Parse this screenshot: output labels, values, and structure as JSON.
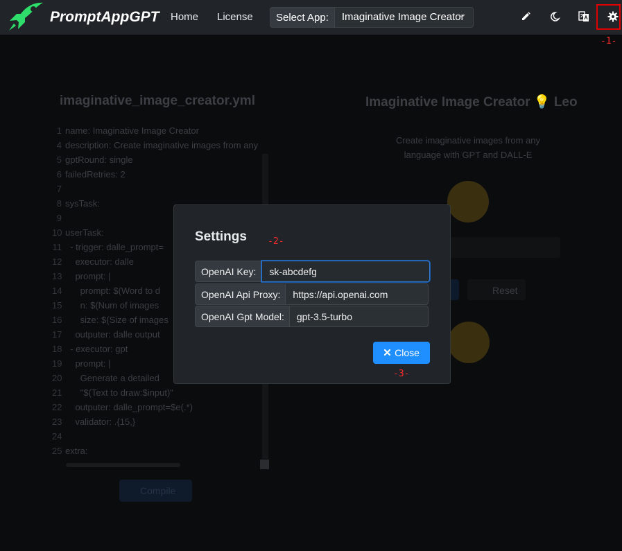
{
  "navbar": {
    "brand": "PromptAppGPT",
    "links": [
      "Home",
      "License"
    ],
    "select_label": "Select App:",
    "select_value": "Imaginative Image Creator",
    "icons": [
      "pencil-icon",
      "moon-icon",
      "translate-icon",
      "gear-icon"
    ]
  },
  "markers": {
    "m1": "-1-",
    "m2": "-2-",
    "m3": "-3-"
  },
  "background": {
    "editor_title": "imaginative_image_creator.yml",
    "code_lines": [
      {
        "n": "1",
        "t": "name: Imaginative Image Creator"
      },
      {
        "n": "4",
        "t": "description: Create imaginative images from any"
      },
      {
        "n": "5",
        "t": "gptRound: single"
      },
      {
        "n": "6",
        "t": "failedRetries: 2"
      },
      {
        "n": "7",
        "t": ""
      },
      {
        "n": "8",
        "t": "sysTask:"
      },
      {
        "n": "9",
        "t": ""
      },
      {
        "n": "10",
        "t": "userTask:"
      },
      {
        "n": "11",
        "t": "  - trigger: dalle_prompt="
      },
      {
        "n": "12",
        "t": "    executor: dalle"
      },
      {
        "n": "13",
        "t": "    prompt: |"
      },
      {
        "n": "14",
        "t": "      prompt: $(Word to d"
      },
      {
        "n": "15",
        "t": "      n: $(Num of images"
      },
      {
        "n": "16",
        "t": "      size: $(Size of images"
      },
      {
        "n": "17",
        "t": "    outputer: dalle output"
      },
      {
        "n": "18",
        "t": "  - executor: gpt"
      },
      {
        "n": "19",
        "t": "    prompt: |"
      },
      {
        "n": "20",
        "t": "      Generate a detailed"
      },
      {
        "n": "21",
        "t": "      \"$(Text to draw:$input)\""
      },
      {
        "n": "22",
        "t": "    outputer: dalle_prompt=$e(.*)"
      },
      {
        "n": "23",
        "t": "    validator: .{15,}"
      },
      {
        "n": "24",
        "t": ""
      },
      {
        "n": "25",
        "t": "extra:"
      }
    ],
    "compile_label": "Compile",
    "app_title": "Imaginative Image Creator",
    "app_author": "Leo",
    "app_desc": "Create imaginative images from any language with GPT and DALL-E",
    "reset_label": "Reset"
  },
  "settings": {
    "title": "Settings",
    "fields": [
      {
        "label": "OpenAI Key:",
        "value": "sk-abcdefg"
      },
      {
        "label": "OpenAI Api Proxy:",
        "value": "https://api.openai.com"
      },
      {
        "label": "OpenAI Gpt Model:",
        "value": "gpt-3.5-turbo"
      }
    ],
    "close_label": "Close"
  },
  "colors": {
    "accent": "#1f8fff",
    "brand_green": "#2fdd6a",
    "highlight": "#e00000"
  }
}
